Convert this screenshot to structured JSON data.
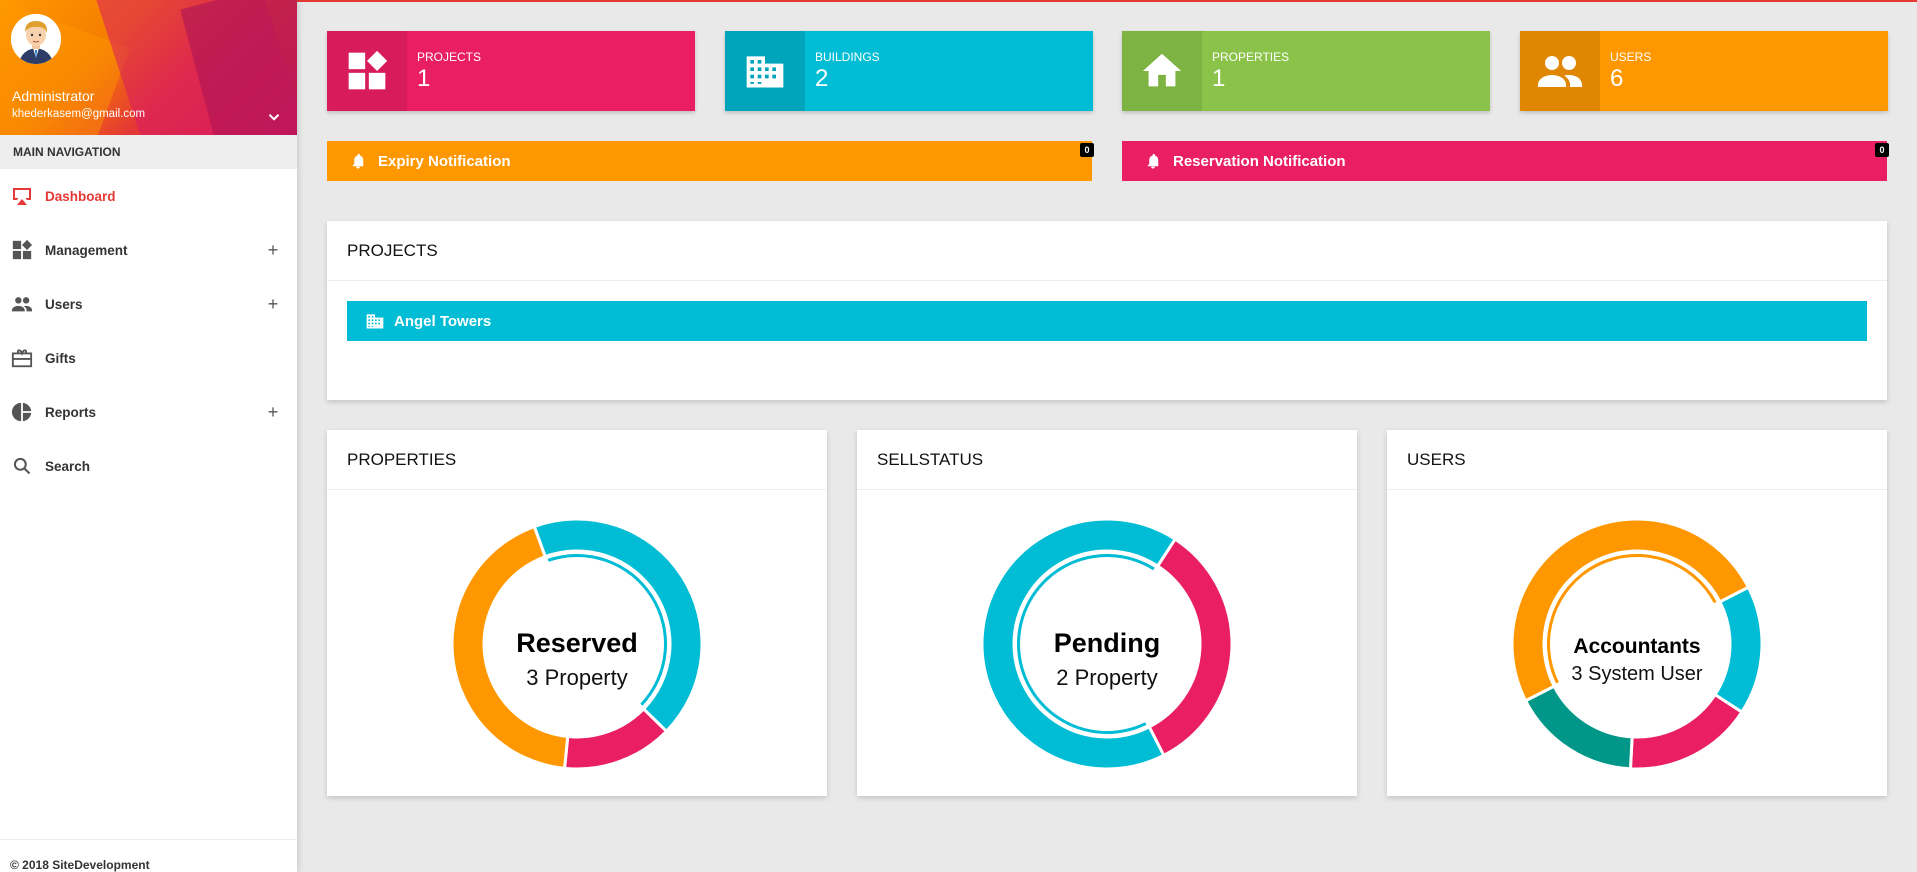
{
  "colors": {
    "pink": "#e91e63",
    "cyan": "#00bcd4",
    "green": "#8bc34a",
    "orange": "#ff9800",
    "teal": "#009688",
    "red_active": "#e53935"
  },
  "sidebar": {
    "user": {
      "name": "Administrator",
      "email": "khederkasem@gmail.com"
    },
    "nav_header": "MAIN NAVIGATION",
    "items": [
      {
        "label": "Dashboard",
        "icon": "airplay-icon",
        "active": true,
        "expandable": false
      },
      {
        "label": "Management",
        "icon": "widgets-icon",
        "active": false,
        "expandable": true
      },
      {
        "label": "Users",
        "icon": "people-icon",
        "active": false,
        "expandable": true
      },
      {
        "label": "Gifts",
        "icon": "gift-card-icon",
        "active": false,
        "expandable": false
      },
      {
        "label": "Reports",
        "icon": "pie-chart-icon",
        "active": false,
        "expandable": true
      },
      {
        "label": "Search",
        "icon": "search-icon",
        "active": false,
        "expandable": false
      }
    ],
    "footer": "© 2018 SiteDevelopment"
  },
  "info_boxes": [
    {
      "label": "PROJECTS",
      "value": "1",
      "icon": "widgets-icon",
      "color": "#e91e63"
    },
    {
      "label": "BUILDINGS",
      "value": "2",
      "icon": "building-icon",
      "color": "#00bcd4"
    },
    {
      "label": "PROPERTIES",
      "value": "1",
      "icon": "home-icon",
      "color": "#8bc34a"
    },
    {
      "label": "USERS",
      "value": "6",
      "icon": "people-icon",
      "color": "#ff9800"
    }
  ],
  "notifications": [
    {
      "label": "Expiry Notification",
      "count": "0",
      "color": "#ff9800",
      "icon": "bell-icon"
    },
    {
      "label": "Reservation Notification",
      "count": "0",
      "color": "#e91e63",
      "icon": "bell-icon"
    }
  ],
  "projects_card": {
    "title": "PROJECTS",
    "items": [
      {
        "name": "Angel Towers",
        "icon": "building-icon"
      }
    ]
  },
  "donut_cards": [
    {
      "title": "PROPERTIES",
      "center_main": "Reserved",
      "center_sub": "3 Property",
      "segments": [
        {
          "value": 3,
          "color": "#00bcd4",
          "highlight": true
        },
        {
          "value": 1,
          "color": "#e91e63"
        },
        {
          "value": 3,
          "color": "#ff9800"
        }
      ],
      "start_angle": 340
    },
    {
      "title": "SELLSTATUS",
      "center_main": "Pending",
      "center_sub": "2 Property",
      "segments": [
        {
          "value": 1,
          "color": "#e91e63"
        },
        {
          "value": 2,
          "color": "#00bcd4",
          "highlight": true
        }
      ],
      "start_angle": 33
    },
    {
      "title": "USERS",
      "center_main": "Accountants",
      "center_sub": "3 System User",
      "segments": [
        {
          "value": 1,
          "color": "#00bcd4"
        },
        {
          "value": 1,
          "color": "#e91e63"
        },
        {
          "value": 1,
          "color": "#009688"
        },
        {
          "value": 3,
          "color": "#ff9800",
          "highlight": true
        }
      ],
      "start_angle": 63
    }
  ]
}
